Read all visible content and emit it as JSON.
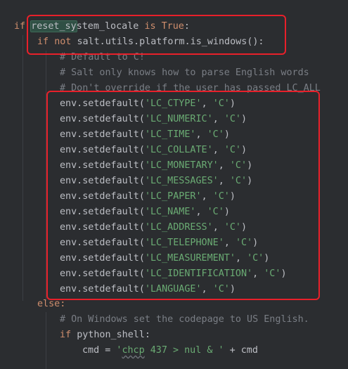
{
  "code": {
    "line1": {
      "kw_if": "if",
      "var_a": "reset_sy",
      "var_b": "stem_locale",
      "kw_is": "is",
      "kw_true": "True",
      "colon": ":"
    },
    "line2": {
      "kw_if": "if",
      "kw_not": "not",
      "call": "salt.utils.platform.is_windows():"
    },
    "comments": [
      "# Default to C!",
      "# Salt only knows how to parse English words",
      "# Don't override if the user has passed LC_ALL"
    ],
    "setdefault_prefix": "env.setdefault(",
    "setdefault_suffix": ")",
    "setdefault_sep": ", ",
    "setdefault_value": "'C'",
    "setdefault_keys": [
      "'LC_CTYPE'",
      "'LC_NUMERIC'",
      "'LC_TIME'",
      "'LC_COLLATE'",
      "'LC_MONETARY'",
      "'LC_MESSAGES'",
      "'LC_PAPER'",
      "'LC_NAME'",
      "'LC_ADDRESS'",
      "'LC_TELEPHONE'",
      "'LC_MEASUREMENT'",
      "'LC_IDENTIFICATION'",
      "'LANGUAGE'"
    ],
    "else_kw": "else:",
    "windows_comment": "# On Windows set the codepage to US English.",
    "line_py": {
      "kw_if": "if",
      "cond": "python_shell:"
    },
    "line_cmd": {
      "lhs": "cmd = ",
      "str_open": "'",
      "str_word": "chcp",
      "str_rest": " 437 > nul & '",
      "rhs": " + cmd"
    }
  },
  "colors": {
    "keyword": "#cf8e6d",
    "comment": "#7a7e85",
    "string": "#6aab73",
    "text": "#bcbec4",
    "background": "#2b2d30",
    "annotation_box": "#e8202a"
  }
}
